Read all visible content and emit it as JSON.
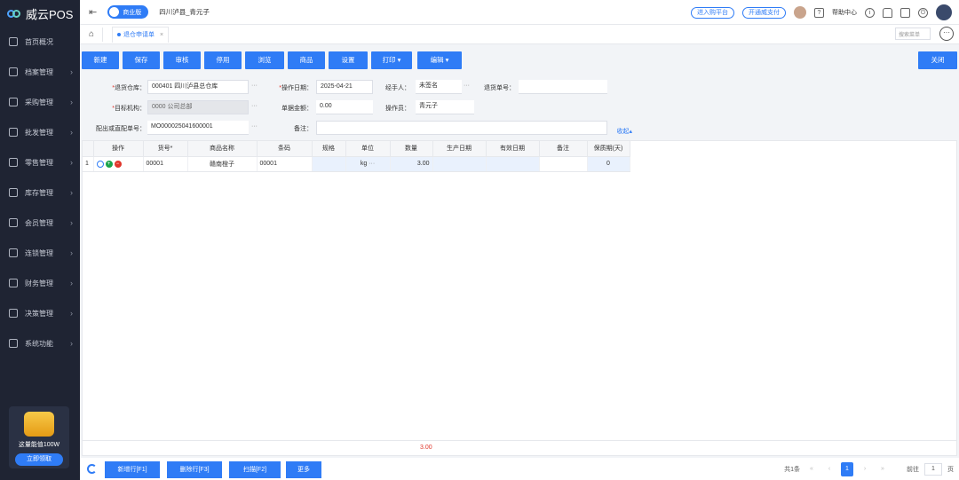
{
  "app": {
    "name": "威云POS"
  },
  "sidebar": {
    "items": [
      {
        "label": "首页概况",
        "icon": "home-icon"
      },
      {
        "label": "档案管理",
        "icon": "archive-icon"
      },
      {
        "label": "采购管理",
        "icon": "cart-icon"
      },
      {
        "label": "批发管理",
        "icon": "wholesale-icon"
      },
      {
        "label": "零售管理",
        "icon": "retail-icon"
      },
      {
        "label": "库存管理",
        "icon": "stock-icon"
      },
      {
        "label": "会员管理",
        "icon": "member-icon"
      },
      {
        "label": "连锁管理",
        "icon": "chain-icon"
      },
      {
        "label": "财务管理",
        "icon": "finance-icon"
      },
      {
        "label": "决策管理",
        "icon": "chart-icon"
      },
      {
        "label": "系统功能",
        "icon": "gear-icon"
      }
    ],
    "promo": {
      "text": "这量能值100W",
      "button": "立即领取"
    }
  },
  "topbar": {
    "edition": "商业版",
    "store": "四川泸县_青元子",
    "link1": "进入购平台",
    "link2": "开通威支付",
    "help": "帮助中心"
  },
  "tabbar": {
    "tab": "退仓申请单",
    "search_placeholder": "搜索菜单"
  },
  "toolbar": {
    "new": "新建",
    "save": "保存",
    "audit": "审核",
    "disable": "停用",
    "browse": "浏览",
    "goods": "商品",
    "settings": "设置",
    "print": "打印",
    "edit": "编辑",
    "close": "关闭"
  },
  "form": {
    "return_warehouse_label": "退货仓库：",
    "return_warehouse_value": "000401  四川泸县总仓库",
    "op_date_label": "操作日期：",
    "op_date_value": "2025-04-21",
    "handler_label": "经手人：",
    "handler_value": "未签名",
    "return_no_label": "退货单号：",
    "target_org_label": "目标机构：",
    "target_org_value": "0000  公司总部",
    "amount_label": "单据金额：",
    "amount_value": "0.00",
    "operator_label": "操作员：",
    "operator_value": "青元子",
    "dist_no_label": "配出或直配单号：",
    "dist_no_value": "MO000025041600001",
    "remark_label": "备注：",
    "collapse": "收起"
  },
  "grid": {
    "headers": [
      "操作",
      "货号*",
      "商品名称",
      "条码",
      "规格",
      "单位",
      "数量",
      "生产日期",
      "有效日期",
      "备注",
      "保质期(天)"
    ],
    "rows": [
      {
        "index": "1",
        "sku": "00001",
        "name": "赣南橙子",
        "barcode": "00001",
        "spec": "",
        "unit": "kg",
        "qty": "3.00",
        "prod_date": "",
        "exp_date": "",
        "remark": "",
        "shelf_life": "0"
      }
    ],
    "total_qty": "3.00"
  },
  "bottom": {
    "add_row": "新增行[F1]",
    "del_row": "删除行[F3]",
    "scan": "扫描[F2]",
    "more": "更多",
    "total": "共1条",
    "page": "1",
    "goto_label": "前往",
    "goto_value": "1",
    "page_unit": "页"
  },
  "colors": {
    "primary": "#2f7cf6",
    "sidebar": "#1f2433",
    "danger": "#e0362b"
  }
}
